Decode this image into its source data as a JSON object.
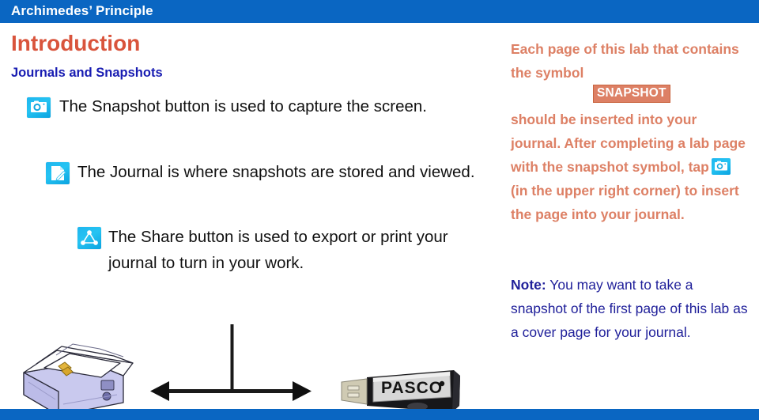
{
  "header": {
    "title": "Archimedes’ Principle",
    "bar_color": "#0a66c2"
  },
  "footer": {
    "bar_color": "#0a66c2"
  },
  "left": {
    "heading": "Introduction",
    "heading_color": "#d9543c",
    "subheading": "Journals and Snapshots",
    "subheading_color": "#181cb2",
    "bullets": [
      {
        "icon": "snapshot-camera-icon",
        "text": "The Snapshot button is used to capture the screen."
      },
      {
        "icon": "journal-document-icon",
        "text": "The Journal is where snapshots are stored and viewed."
      },
      {
        "icon": "share-network-icon",
        "text": "The Share button is used to export or print your journal to turn in your work."
      }
    ],
    "artwork": [
      {
        "name": "projector-illustration"
      },
      {
        "name": "double-arrow-diagram"
      },
      {
        "name": "pasco-usb-drive-illustration",
        "label": "PASCO"
      }
    ]
  },
  "right": {
    "text_color": "#dd8065",
    "paragraph_a": "Each page of this lab that contains the symbol",
    "snapshot_badge": "SNAPSHOT",
    "badge_bg": "#dd8065",
    "paragraph_b_part1": "should be inserted into your journal. After completing a lab page with the snapshot symbol, tap",
    "paragraph_b_part2": "(in the upper right corner) to insert the page into your journal.",
    "inline_icon": "snapshot-camera-icon",
    "note_label": "Note:",
    "note_text": " You may want to take a snapshot of the first page of this lab as a cover page for your journal.",
    "note_color": "#20209a"
  }
}
